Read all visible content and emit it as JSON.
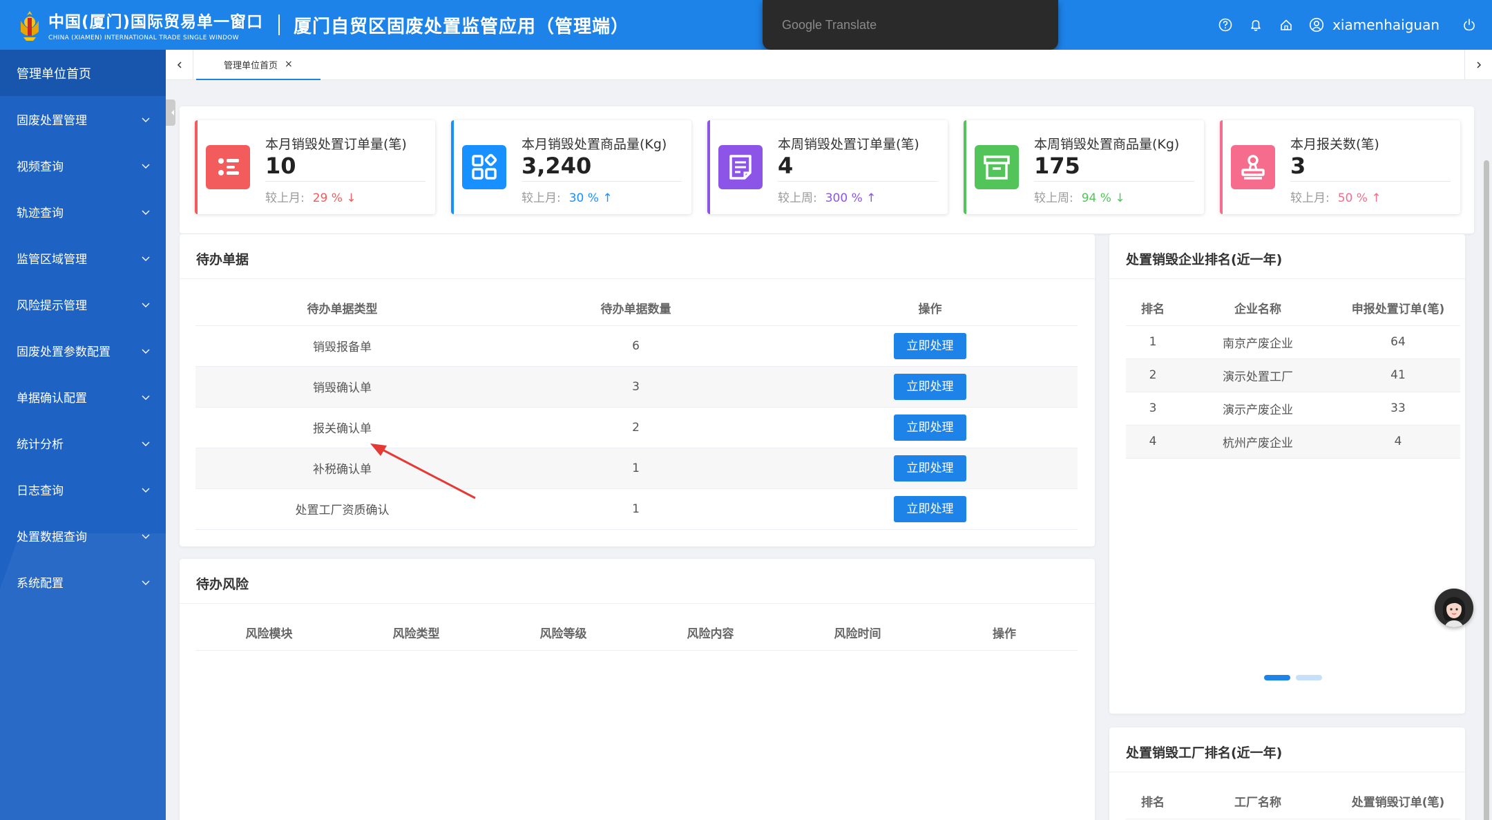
{
  "header": {
    "logo_cn": "中国(厦门)国际贸易单一窗口",
    "logo_en": "CHINA (XIAMEN) INTERNATIONAL TRADE SINGLE WINDOW",
    "app_title": "厦门自贸区固废处置监管应用（管理端）",
    "user_name": "xiamenhaiguan",
    "translate_overlay": "Google Translate",
    "icons": [
      "help-icon",
      "bell-icon",
      "home-icon",
      "user-icon",
      "power-icon"
    ]
  },
  "sidebar": {
    "items": [
      {
        "label": "管理单位首页",
        "active": true
      },
      {
        "label": "固废处置管理"
      },
      {
        "label": "视频查询"
      },
      {
        "label": "轨迹查询"
      },
      {
        "label": "监管区域管理"
      },
      {
        "label": "风险提示管理"
      },
      {
        "label": "固废处置参数配置"
      },
      {
        "label": "单据确认配置"
      },
      {
        "label": "统计分析"
      },
      {
        "label": "日志查询"
      },
      {
        "label": "处置数据查询"
      },
      {
        "label": "系统配置"
      }
    ]
  },
  "tabs": [
    {
      "label": "管理单位首页",
      "close": "×"
    }
  ],
  "stats": [
    {
      "label": "本月销毁处置订单量(笔)",
      "value": "10",
      "cmp_label": "较上月:",
      "pct": "29 % ↓",
      "color": "#f25c5c",
      "icon": "list-icon"
    },
    {
      "label": "本月销毁处置商品量(Kg)",
      "value": "3,240",
      "cmp_label": "较上月:",
      "pct": "30 % ↑",
      "color": "#1890ff",
      "icon": "apps-icon"
    },
    {
      "label": "本周销毁处置订单量(笔)",
      "value": "4",
      "cmp_label": "较上周:",
      "pct": "300 % ↑",
      "color": "#8c55e8",
      "icon": "document-icon"
    },
    {
      "label": "本周销毁处置商品量(Kg)",
      "value": "175",
      "cmp_label": "较上周:",
      "pct": "94 % ↓",
      "color": "#52c45a",
      "icon": "archive-icon"
    },
    {
      "label": "本月报关数(笔)",
      "value": "3",
      "cmp_label": "较上月:",
      "pct": "50 % ↑",
      "color": "#f56c8c",
      "icon": "stamp-icon"
    }
  ],
  "pending": {
    "title": "待办单据",
    "headers": [
      "待办单据类型",
      "待办单据数量",
      "操作"
    ],
    "rows": [
      {
        "type": "销毁报备单",
        "count": "6",
        "action": "立即处理"
      },
      {
        "type": "销毁确认单",
        "count": "3",
        "action": "立即处理"
      },
      {
        "type": "报关确认单",
        "count": "2",
        "action": "立即处理"
      },
      {
        "type": "补税确认单",
        "count": "1",
        "action": "立即处理"
      },
      {
        "type": "处置工厂资质确认",
        "count": "1",
        "action": "立即处理"
      }
    ]
  },
  "risk": {
    "title": "待办风险",
    "headers": [
      "风险模块",
      "风险类型",
      "风险等级",
      "风险内容",
      "风险时间",
      "操作"
    ]
  },
  "enterprise_rank": {
    "title": "处置销毁企业排名(近一年)",
    "headers": [
      "排名",
      "企业名称",
      "申报处置订单(笔)"
    ],
    "rows": [
      {
        "rank": "1",
        "name": "南京产废企业",
        "count": "64"
      },
      {
        "rank": "2",
        "name": "演示处置工厂",
        "count": "41"
      },
      {
        "rank": "3",
        "name": "演示产废企业",
        "count": "33"
      },
      {
        "rank": "4",
        "name": "杭州产废企业",
        "count": "4"
      }
    ],
    "active_page": 1,
    "page_count": 2
  },
  "factory_rank": {
    "title": "处置销毁工厂排名(近一年)",
    "headers": [
      "排名",
      "工厂名称",
      "处置销毁订单(笔)"
    ]
  },
  "colors": {
    "primary": "#1d83e9",
    "sidebar": "#1e63c4",
    "annotation_arrow": "#e53935"
  }
}
